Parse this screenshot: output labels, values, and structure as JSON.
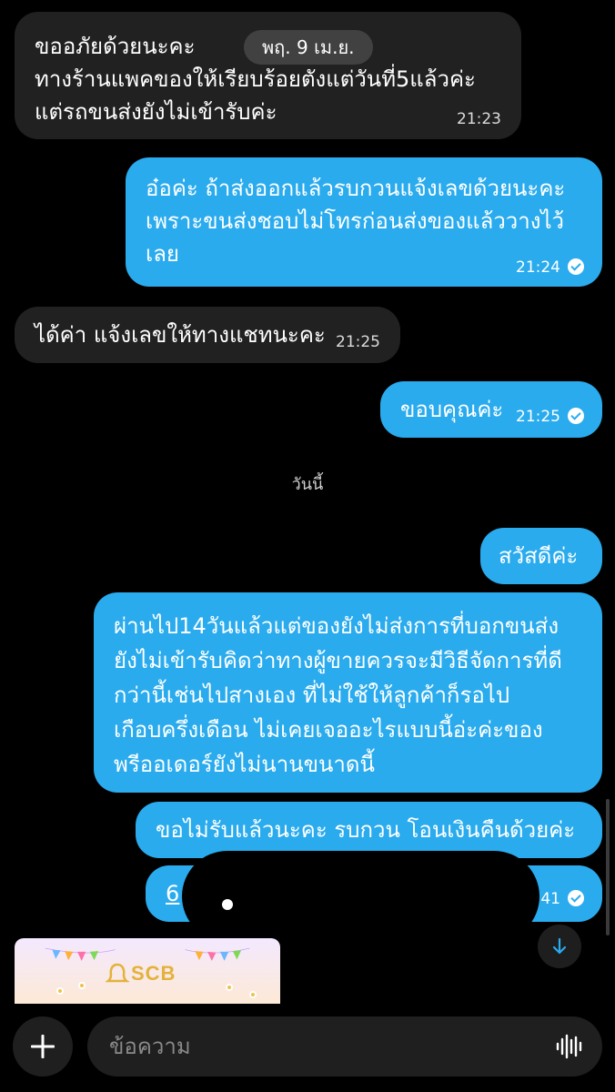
{
  "date_pill": "พฤ. 9 เม.ย.",
  "today_divider": "วันนี้",
  "messages": [
    {
      "text": "ขออภัยด้วยนะคะ\nทางร้านแพคของให้เรียบร้อยตังแต่วันที่5แล้วค่ะ\nแต่รถขนส่งยังไม่เข้ารับค่ะ",
      "time": "21:23"
    },
    {
      "text": "อ๋อค่ะ ถ้าส่งออกแล้วรบกวนแจ้งเลขด้วยนะคะ\nเพราะขนส่งชอบไม่โทรก่อนส่งของแล้ววางไว้\nเลย",
      "time": "21:24"
    },
    {
      "text": "ได้ค่า แจ้งเลขให้ทางแชทนะคะ",
      "time": "21:25"
    },
    {
      "text": "ขอบคุณค่ะ",
      "time": "21:25"
    },
    {
      "text": "สวัสดีค่ะ"
    },
    {
      "text": "ผ่านไป14วันแล้วแต่ของยังไม่ส่งการที่บอกขนส่ง\nยังไม่เข้ารับคิดว่าทางผู้ขายควรจะมีวิธีจัดการที่ดี\nกว่านี้เช่นไปสางเอง ที่ไม่ใช้ให้ลูกค้าก็รอไป\nเกือบครึ่งเดือน ไม่เคยเจออะไรแบบนี้อ่ะค่ะของ\nพรีออเดอร์ยังไม่นานขนาดนี้"
    },
    {
      "text": "ขอไม่รับแล้วนะคะ รบกวน โอนเงินคืนด้วยค่ะ"
    },
    {
      "text": "6",
      "time": "41"
    }
  ],
  "banner": {
    "logo_text": "SCB"
  },
  "composer": {
    "placeholder": "ข้อความ"
  },
  "icons": {
    "add": "plus-icon",
    "voice": "voice-wave-icon",
    "scroll_down": "arrow-down-icon",
    "read": "check-circle-icon"
  },
  "colors": {
    "outgoing": "#2AABEE",
    "incoming": "#212121",
    "background": "#000000"
  }
}
